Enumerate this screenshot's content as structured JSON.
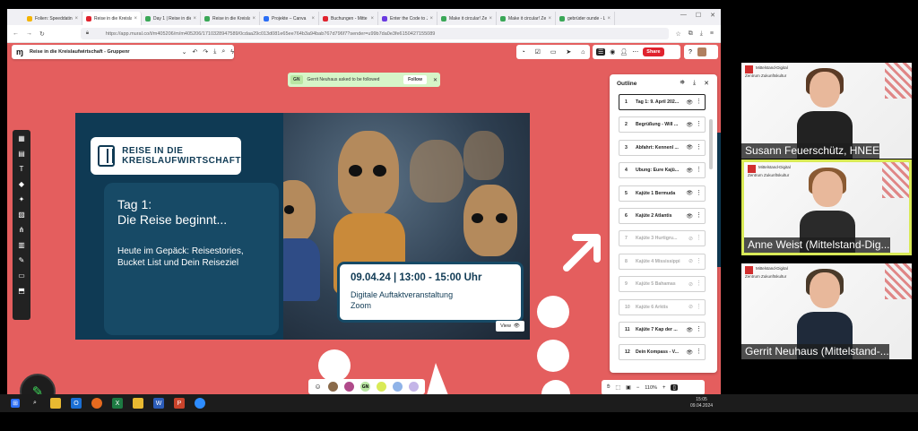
{
  "browser": {
    "tabs": [
      {
        "label": "Folien: Speeddatin",
        "color": "#f4b400"
      },
      {
        "label": "Reise in die Kreisla",
        "color": "#e0232e"
      },
      {
        "label": "Day 1 | Reise in die",
        "color": "#3aa757"
      },
      {
        "label": "Reise in die Kreisla",
        "color": "#3aa757"
      },
      {
        "label": "Projekte – Canva",
        "color": "#2b6ef5"
      },
      {
        "label": "Buchungen - Mitte",
        "color": "#e0232e"
      },
      {
        "label": "Enter the Code to Jo",
        "color": "#6a3ae0"
      },
      {
        "label": "Make it circular! Ze",
        "color": "#3aa757"
      },
      {
        "label": "Make it circular! Ze",
        "color": "#3aa757"
      },
      {
        "label": "gebrüder ounde - L",
        "color": "#3aa757"
      }
    ],
    "url": "https://app.mural.co/t/m405206/m/m405206/1710328947589/0cdaa29c013d081e65ee764b3a94bab767d796f7?sender=u99b7da0e3fe6150427155089"
  },
  "mural": {
    "title": "Reise in die Kreislaufwirtschaft - Gruppenr",
    "notification": {
      "initials": "GN",
      "message": "Gerrit Neuhaus asked to be followed",
      "follow_label": "Follow"
    },
    "share_label": "Share",
    "zoom": "110%",
    "view_label": "View",
    "bottom_initials": "GN"
  },
  "slide": {
    "brand_line1": "REISE IN DIE",
    "brand_line2": "KREISLAUFWIRTSCHAFT",
    "heading_line1": "Tag 1:",
    "heading_line2": "Die Reise beginnt...",
    "body": "Heute im Gepäck: Reisestories, Bucket List und Dein Reiseziel",
    "date": "09.04.24 | 13:00 - 15:00 Uhr",
    "event_line1": "Digitale Auftaktveranstaltung",
    "event_line2": "Zoom"
  },
  "outline": {
    "title": "Outline",
    "items": [
      {
        "num": "1",
        "label": "Tag 1: 9. April 202...",
        "selected": true,
        "dim": false
      },
      {
        "num": "2",
        "label": "Begrüßung - Will ...",
        "selected": false,
        "dim": false
      },
      {
        "num": "3",
        "label": "Abfahrt: Kennenl ...",
        "selected": false,
        "dim": false
      },
      {
        "num": "4",
        "label": "Übung: Eure Kajü...",
        "selected": false,
        "dim": false
      },
      {
        "num": "5",
        "label": "Kajüte 1 Bermuda",
        "selected": false,
        "dim": false
      },
      {
        "num": "6",
        "label": "Kajüte 2 Atlantis",
        "selected": false,
        "dim": false
      },
      {
        "num": "7",
        "label": "Kajüte 3 Hurtigru...",
        "selected": false,
        "dim": true
      },
      {
        "num": "8",
        "label": "Kajüte 4 Mississippi",
        "selected": false,
        "dim": true
      },
      {
        "num": "9",
        "label": "Kajüte 5 Bahamas",
        "selected": false,
        "dim": true
      },
      {
        "num": "10",
        "label": "Kajüte 6 Arktis",
        "selected": false,
        "dim": true
      },
      {
        "num": "11",
        "label": "Kajüte 7 Kap der ...",
        "selected": false,
        "dim": false
      },
      {
        "num": "12",
        "label": "Dein Kompass - V...",
        "selected": false,
        "dim": false
      }
    ]
  },
  "video": {
    "participants": [
      {
        "name": "Susann Feuerschütz, HNEE",
        "active": false
      },
      {
        "name": "Anne Weist (Mittelstand-Dig...",
        "active": true
      },
      {
        "name": "Gerrit Neuhaus (Mittelstand-...",
        "active": false
      }
    ],
    "logo_text": "Mittelstand-Digital Zentrum Zukunftskultur"
  },
  "taskbar": {
    "time": "15:05",
    "date": "09.04.2024"
  },
  "colors": {
    "canvas": "#e45e5e",
    "slide": "#0f3a54",
    "share": "#e0232e",
    "active_speaker": "#d9ea57"
  }
}
